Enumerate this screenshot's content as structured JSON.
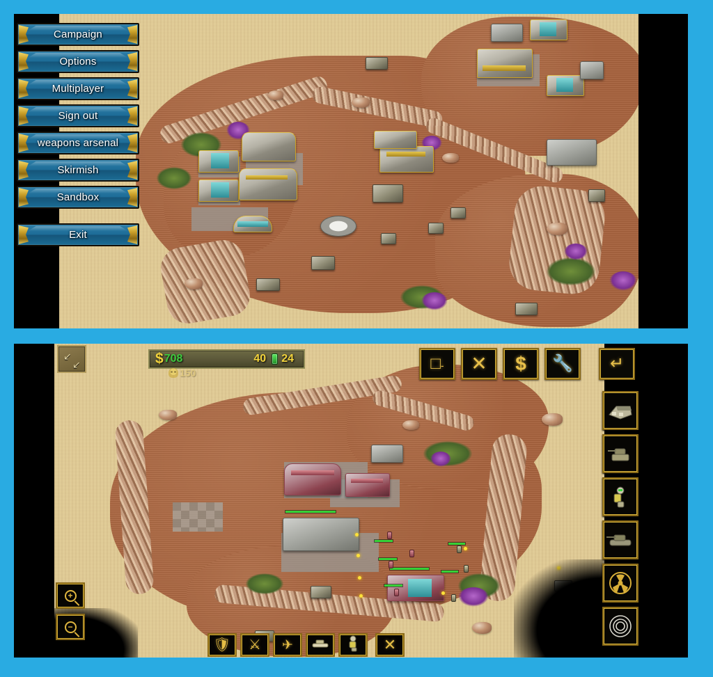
{
  "app": {
    "title": "RTS Game - Composite Screenshot",
    "border_color": "#29abe2",
    "panels": 2
  },
  "top_panel": {
    "name": "main-menu-screen",
    "menu": {
      "items": [
        {
          "id": "campaign",
          "label": "Campaign"
        },
        {
          "id": "options",
          "label": "Options"
        },
        {
          "id": "multiplayer",
          "label": "Multiplayer"
        },
        {
          "id": "sign-out",
          "label": "Sign out"
        },
        {
          "id": "weapons-arsenal",
          "label": "weapons arsenal"
        },
        {
          "id": "skirmish",
          "label": "Skirmish"
        },
        {
          "id": "sandbox",
          "label": "Sandbox"
        }
      ],
      "exit": {
        "id": "exit",
        "label": "Exit"
      }
    },
    "scene": {
      "description": "Isometric desert battlefield with GDI-style yellow/grey base structures",
      "terrain": "desert sand with reddish dirt plateau and rock ridges"
    }
  },
  "bottom_panel": {
    "name": "in-game-hud-screen",
    "resources": {
      "credits_icon": "dollar-icon",
      "credits": "708",
      "credits_color": "#3ecb3e",
      "power_produced": "40",
      "power_icon": "power-cell-icon",
      "power_consumed": "24",
      "numbers_color": "#f2d33c"
    },
    "casualties": {
      "icon": "skull-icon",
      "count": "150"
    },
    "minimap_toggle": {
      "icon": "expand-arrows-icon",
      "label": ""
    },
    "top_toolbar": [
      {
        "id": "deploy",
        "icon": "deploy-square-icon",
        "glyph": "□"
      },
      {
        "id": "cancel",
        "icon": "close-x-icon",
        "glyph": "✕"
      },
      {
        "id": "sell",
        "icon": "sell-dollar-icon",
        "glyph": "$"
      },
      {
        "id": "repair",
        "icon": "wrench-icon",
        "glyph": "⚒"
      },
      {
        "id": "exit-game",
        "icon": "exit-arrow-icon",
        "glyph": "↩"
      }
    ],
    "build_sidebar": [
      {
        "id": "build-structure",
        "icon": "barracks-building-icon"
      },
      {
        "id": "build-turret",
        "icon": "turret-tank-icon"
      },
      {
        "id": "build-infantry",
        "icon": "infantry-soldier-icon"
      },
      {
        "id": "build-vehicle",
        "icon": "battle-tank-icon"
      },
      {
        "id": "superweapon",
        "icon": "radiation-nuke-icon"
      },
      {
        "id": "settings",
        "icon": "gear-icon"
      }
    ],
    "command_bar": [
      {
        "id": "defense-tab",
        "icon": "shield-icon"
      },
      {
        "id": "attack-tab",
        "icon": "sword-icon"
      },
      {
        "id": "aircraft-tab",
        "icon": "aircraft-icon"
      },
      {
        "id": "vehicle-tab",
        "icon": "tank-icon"
      },
      {
        "id": "infantry-tab",
        "icon": "soldier-icon"
      }
    ],
    "cancel_button": {
      "id": "cancel-order",
      "icon": "close-x-icon",
      "glyph": "✕"
    },
    "zoom_controls": [
      {
        "id": "zoom-in",
        "icon": "magnifier-plus-icon",
        "glyph": "+"
      },
      {
        "id": "zoom-out",
        "icon": "magnifier-minus-icon",
        "glyph": "−"
      }
    ],
    "scene": {
      "description": "Isometric desert battlefield, Nod-style red base under attack with infantry skirmish",
      "terrain": "desert sand with reddish dirt plateau and rock ridges"
    }
  }
}
